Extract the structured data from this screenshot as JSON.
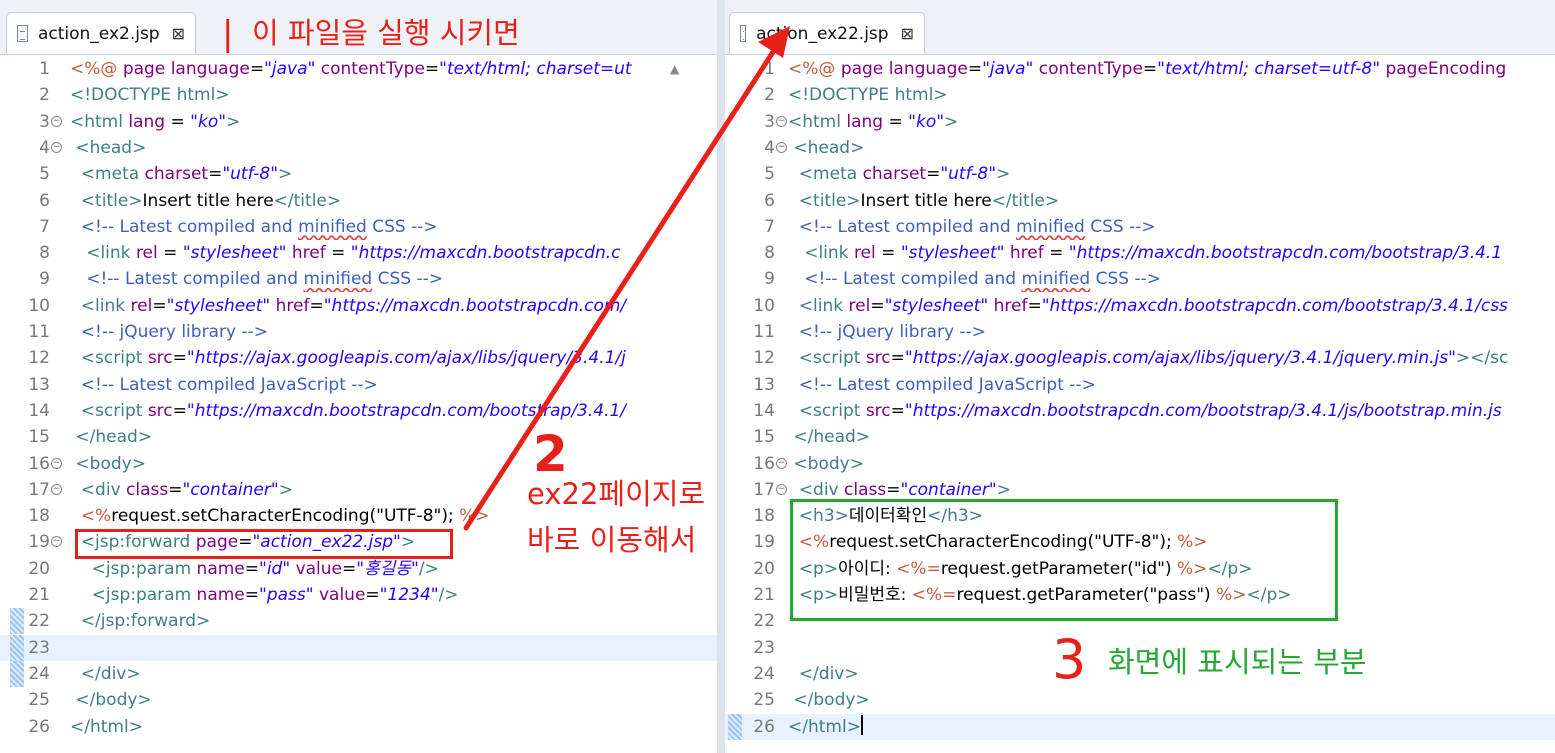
{
  "left_editor": {
    "tab_title": "action_ex2.jsp",
    "lines": [
      {
        "n": "1",
        "fold": false,
        "parts": [
          [
            "jt",
            "<%@ "
          ],
          [
            "a",
            "page "
          ],
          [
            "a",
            "language"
          ],
          [
            "tx",
            "="
          ],
          [
            "v",
            "\"java\""
          ],
          [
            "tx",
            " "
          ],
          [
            "a",
            "contentType"
          ],
          [
            "tx",
            "="
          ],
          [
            "v",
            "\"text/html; charset=ut"
          ]
        ]
      },
      {
        "n": "2",
        "fold": false,
        "parts": [
          [
            "t",
            "<!DOCTYPE html>"
          ]
        ]
      },
      {
        "n": "3",
        "fold": true,
        "parts": [
          [
            "t",
            "<html "
          ],
          [
            "a",
            "lang"
          ],
          [
            "tx",
            " = "
          ],
          [
            "v",
            "\"ko\""
          ],
          [
            "t",
            ">"
          ]
        ]
      },
      {
        "n": "4",
        "fold": true,
        "parts": [
          [
            "t",
            " <head>"
          ]
        ]
      },
      {
        "n": "5",
        "fold": false,
        "parts": [
          [
            "t",
            "  <meta "
          ],
          [
            "a",
            "charset"
          ],
          [
            "tx",
            "="
          ],
          [
            "v",
            "\"utf-8\""
          ],
          [
            "t",
            ">"
          ]
        ]
      },
      {
        "n": "6",
        "fold": false,
        "parts": [
          [
            "t",
            "  <title>"
          ],
          [
            "tx",
            "Insert title here"
          ],
          [
            "t",
            "</title>"
          ]
        ]
      },
      {
        "n": "7",
        "fold": false,
        "parts": [
          [
            "cm",
            "  <!-- Latest compiled and "
          ],
          [
            "cm sq",
            "minified"
          ],
          [
            "cm",
            " CSS -->"
          ]
        ]
      },
      {
        "n": "8",
        "fold": false,
        "parts": [
          [
            "t",
            "   <link "
          ],
          [
            "a",
            "rel"
          ],
          [
            "tx",
            " = "
          ],
          [
            "v",
            "\"stylesheet\""
          ],
          [
            "tx",
            " "
          ],
          [
            "a",
            "href"
          ],
          [
            "tx",
            " = "
          ],
          [
            "v",
            "\"https://maxcdn.bootstrapcdn.c"
          ]
        ]
      },
      {
        "n": "9",
        "fold": false,
        "parts": [
          [
            "cm",
            "   <!-- Latest compiled and "
          ],
          [
            "cm sq",
            "minified"
          ],
          [
            "cm",
            " CSS -->"
          ]
        ]
      },
      {
        "n": "10",
        "fold": false,
        "parts": [
          [
            "t",
            "  <link "
          ],
          [
            "a",
            "rel"
          ],
          [
            "tx",
            "="
          ],
          [
            "v",
            "\"stylesheet\""
          ],
          [
            "tx",
            " "
          ],
          [
            "a",
            "href"
          ],
          [
            "tx",
            "="
          ],
          [
            "v",
            "\"https://maxcdn.bootstrapcdn.com/"
          ]
        ]
      },
      {
        "n": "11",
        "fold": false,
        "parts": [
          [
            "cm",
            "  <!-- jQuery library -->"
          ]
        ]
      },
      {
        "n": "12",
        "fold": false,
        "parts": [
          [
            "t",
            "  <script "
          ],
          [
            "a",
            "src"
          ],
          [
            "tx",
            "="
          ],
          [
            "v",
            "\"https://ajax.googleapis.com/ajax/libs/jquery/3.4.1/j"
          ]
        ]
      },
      {
        "n": "13",
        "fold": false,
        "parts": [
          [
            "cm",
            "  <!-- Latest compiled JavaScript -->"
          ]
        ]
      },
      {
        "n": "14",
        "fold": false,
        "parts": [
          [
            "t",
            "  <script "
          ],
          [
            "a",
            "src"
          ],
          [
            "tx",
            "="
          ],
          [
            "v",
            "\"https://maxcdn.bootstrapcdn.com/bootstrap/3.4.1/"
          ]
        ]
      },
      {
        "n": "15",
        "fold": false,
        "parts": [
          [
            "t",
            " </head>"
          ]
        ]
      },
      {
        "n": "16",
        "fold": true,
        "parts": [
          [
            "t",
            " <body>"
          ]
        ]
      },
      {
        "n": "17",
        "fold": true,
        "parts": [
          [
            "t",
            "  <div "
          ],
          [
            "a",
            "class"
          ],
          [
            "tx",
            "="
          ],
          [
            "v",
            "\"container\""
          ],
          [
            "t",
            ">"
          ]
        ]
      },
      {
        "n": "18",
        "fold": false,
        "parts": [
          [
            "jt",
            "  <%"
          ],
          [
            "tx",
            "request.setCharacterEncoding(\"UTF-8\"); "
          ],
          [
            "jt",
            "%>"
          ]
        ]
      },
      {
        "n": "19",
        "fold": true,
        "parts": [
          [
            "t",
            "  <jsp:forward "
          ],
          [
            "a",
            "page"
          ],
          [
            "tx",
            "="
          ],
          [
            "v",
            "\"action_ex22.jsp\""
          ],
          [
            "t",
            ">"
          ]
        ]
      },
      {
        "n": "20",
        "fold": false,
        "parts": [
          [
            "t",
            "    <jsp:param "
          ],
          [
            "a",
            "name"
          ],
          [
            "tx",
            "="
          ],
          [
            "v",
            "\"id\""
          ],
          [
            "tx",
            " "
          ],
          [
            "a",
            "value"
          ],
          [
            "tx",
            "="
          ],
          [
            "v",
            "\"홍길동\""
          ],
          [
            "t",
            "/>"
          ]
        ]
      },
      {
        "n": "21",
        "fold": false,
        "parts": [
          [
            "t",
            "    <jsp:param "
          ],
          [
            "a",
            "name"
          ],
          [
            "tx",
            "="
          ],
          [
            "v",
            "\"pass\""
          ],
          [
            "tx",
            " "
          ],
          [
            "a",
            "value"
          ],
          [
            "tx",
            "="
          ],
          [
            "v",
            "\"1234\""
          ],
          [
            "t",
            "/>"
          ]
        ]
      },
      {
        "n": "22",
        "fold": false,
        "parts": [
          [
            "t",
            "  </jsp:forward>"
          ]
        ]
      },
      {
        "n": "23",
        "fold": false,
        "parts": []
      },
      {
        "n": "24",
        "fold": false,
        "parts": [
          [
            "t",
            "  </div>"
          ]
        ]
      },
      {
        "n": "25",
        "fold": false,
        "parts": [
          [
            "t",
            " </body>"
          ]
        ]
      },
      {
        "n": "26",
        "fold": false,
        "parts": [
          [
            "t",
            "</html>"
          ]
        ]
      }
    ]
  },
  "right_editor": {
    "tab_title": "action_ex22.jsp",
    "lines": [
      {
        "n": "1",
        "fold": false,
        "parts": [
          [
            "jt",
            "<%@ "
          ],
          [
            "a",
            "page "
          ],
          [
            "a",
            "language"
          ],
          [
            "tx",
            "="
          ],
          [
            "v",
            "\"java\""
          ],
          [
            "tx",
            " "
          ],
          [
            "a",
            "contentType"
          ],
          [
            "tx",
            "="
          ],
          [
            "v",
            "\"text/html; charset=utf-8\""
          ],
          [
            "tx",
            " "
          ],
          [
            "a",
            "pageEncoding"
          ]
        ]
      },
      {
        "n": "2",
        "fold": false,
        "parts": [
          [
            "t",
            "<!DOCTYPE html>"
          ]
        ]
      },
      {
        "n": "3",
        "fold": true,
        "parts": [
          [
            "t",
            "<html "
          ],
          [
            "a",
            "lang"
          ],
          [
            "tx",
            " = "
          ],
          [
            "v",
            "\"ko\""
          ],
          [
            "t",
            ">"
          ]
        ]
      },
      {
        "n": "4",
        "fold": true,
        "parts": [
          [
            "t",
            " <head>"
          ]
        ]
      },
      {
        "n": "5",
        "fold": false,
        "parts": [
          [
            "t",
            "  <meta "
          ],
          [
            "a",
            "charset"
          ],
          [
            "tx",
            "="
          ],
          [
            "v",
            "\"utf-8\""
          ],
          [
            "t",
            ">"
          ]
        ]
      },
      {
        "n": "6",
        "fold": false,
        "parts": [
          [
            "t",
            "  <title>"
          ],
          [
            "tx",
            "Insert title here"
          ],
          [
            "t",
            "</title>"
          ]
        ]
      },
      {
        "n": "7",
        "fold": false,
        "parts": [
          [
            "cm",
            "  <!-- Latest compiled and "
          ],
          [
            "cm sq",
            "minified"
          ],
          [
            "cm",
            " CSS -->"
          ]
        ]
      },
      {
        "n": "8",
        "fold": false,
        "parts": [
          [
            "t",
            "   <link "
          ],
          [
            "a",
            "rel"
          ],
          [
            "tx",
            " = "
          ],
          [
            "v",
            "\"stylesheet\""
          ],
          [
            "tx",
            " "
          ],
          [
            "a",
            "href"
          ],
          [
            "tx",
            " = "
          ],
          [
            "v",
            "\"https://maxcdn.bootstrapcdn.com/bootstrap/3.4.1"
          ]
        ]
      },
      {
        "n": "9",
        "fold": false,
        "parts": [
          [
            "cm",
            "   <!-- Latest compiled and "
          ],
          [
            "cm sq",
            "minified"
          ],
          [
            "cm",
            " CSS -->"
          ]
        ]
      },
      {
        "n": "10",
        "fold": false,
        "parts": [
          [
            "t",
            "  <link "
          ],
          [
            "a",
            "rel"
          ],
          [
            "tx",
            "="
          ],
          [
            "v",
            "\"stylesheet\""
          ],
          [
            "tx",
            " "
          ],
          [
            "a",
            "href"
          ],
          [
            "tx",
            "="
          ],
          [
            "v",
            "\"https://maxcdn.bootstrapcdn.com/bootstrap/3.4.1/css"
          ]
        ]
      },
      {
        "n": "11",
        "fold": false,
        "parts": [
          [
            "cm",
            "  <!-- jQuery library -->"
          ]
        ]
      },
      {
        "n": "12",
        "fold": false,
        "parts": [
          [
            "t",
            "  <script "
          ],
          [
            "a",
            "src"
          ],
          [
            "tx",
            "="
          ],
          [
            "v",
            "\"https://ajax.googleapis.com/ajax/libs/jquery/3.4.1/jquery.min.js\""
          ],
          [
            "t",
            "></sc"
          ]
        ]
      },
      {
        "n": "13",
        "fold": false,
        "parts": [
          [
            "cm",
            "  <!-- Latest compiled JavaScript -->"
          ]
        ]
      },
      {
        "n": "14",
        "fold": false,
        "parts": [
          [
            "t",
            "  <script "
          ],
          [
            "a",
            "src"
          ],
          [
            "tx",
            "="
          ],
          [
            "v",
            "\"https://maxcdn.bootstrapcdn.com/bootstrap/3.4.1/js/bootstrap.min.js"
          ]
        ]
      },
      {
        "n": "15",
        "fold": false,
        "parts": [
          [
            "t",
            " </head>"
          ]
        ]
      },
      {
        "n": "16",
        "fold": true,
        "parts": [
          [
            "t",
            " <body>"
          ]
        ]
      },
      {
        "n": "17",
        "fold": true,
        "parts": [
          [
            "t",
            "  <div "
          ],
          [
            "a",
            "class"
          ],
          [
            "tx",
            "="
          ],
          [
            "v",
            "\"container\""
          ],
          [
            "t",
            ">"
          ]
        ]
      },
      {
        "n": "18",
        "fold": false,
        "parts": [
          [
            "t",
            "  <h3>"
          ],
          [
            "tx",
            "데이터확인"
          ],
          [
            "t",
            "</h3>"
          ]
        ]
      },
      {
        "n": "19",
        "fold": false,
        "parts": [
          [
            "jt",
            "  <%"
          ],
          [
            "tx",
            "request.setCharacterEncoding(\"UTF-8\"); "
          ],
          [
            "jt",
            "%>"
          ]
        ]
      },
      {
        "n": "20",
        "fold": false,
        "parts": [
          [
            "t",
            "  <p>"
          ],
          [
            "tx",
            "아이디: "
          ],
          [
            "jt",
            "<%="
          ],
          [
            "tx",
            "request.getParameter(\"id\") "
          ],
          [
            "jt",
            "%>"
          ],
          [
            "t",
            "</p>"
          ]
        ]
      },
      {
        "n": "21",
        "fold": false,
        "parts": [
          [
            "t",
            "  <p>"
          ],
          [
            "tx",
            "비밀번호: "
          ],
          [
            "jt",
            "<%="
          ],
          [
            "tx",
            "request.getParameter(\"pass\") "
          ],
          [
            "jt",
            "%>"
          ],
          [
            "t",
            "</p>"
          ]
        ]
      },
      {
        "n": "22",
        "fold": false,
        "parts": []
      },
      {
        "n": "23",
        "fold": false,
        "parts": []
      },
      {
        "n": "24",
        "fold": false,
        "parts": [
          [
            "t",
            "  </div>"
          ]
        ]
      },
      {
        "n": "25",
        "fold": false,
        "parts": [
          [
            "t",
            " </body>"
          ]
        ]
      },
      {
        "n": "26",
        "fold": false,
        "parts": [
          [
            "t",
            "</html>"
          ]
        ]
      }
    ]
  },
  "annotations": {
    "step1_mark": "|",
    "step1_text": "이 파일을 실행 시키면",
    "step2_mark": "2",
    "step2_line1": "ex22페이지로",
    "step2_line2": "바로 이동해서",
    "step3_mark": "3",
    "step3_text": "화면에 표시되는 부분"
  },
  "colors": {
    "annotation_red": "#e8201a",
    "annotation_green": "#26a632",
    "tag": "#3f7f7f",
    "attribute": "#7f007f",
    "value": "#2a00ff",
    "comment": "#3f5fbf",
    "jsp_tag": "#bf5f3f"
  },
  "icons": {
    "tab_file": "file-icon",
    "tab_close": "close-icon",
    "fold_marker": "fold-collapse-icon"
  }
}
